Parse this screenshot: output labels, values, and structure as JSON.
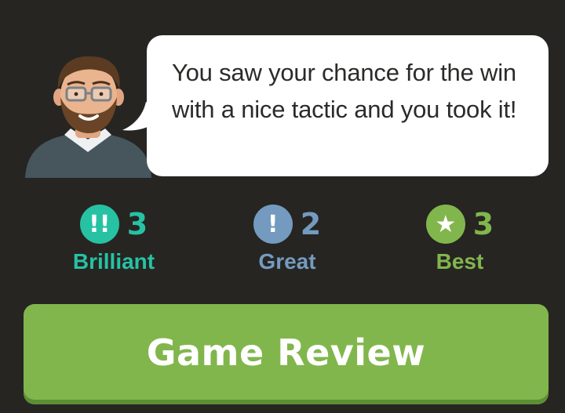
{
  "coach": {
    "avatar_icon": "coach-avatar-icon",
    "message": "You saw your chance for the win with a nice tactic and you took it!"
  },
  "stats": [
    {
      "key": "brilliant",
      "label": "Brilliant",
      "count": "3",
      "icon_text": "!!",
      "icon": "brilliant-move-icon",
      "color": "#26c2a3"
    },
    {
      "key": "great",
      "label": "Great",
      "count": "2",
      "icon_text": "!",
      "icon": "great-move-icon",
      "color": "#749bbf"
    },
    {
      "key": "best",
      "label": "Best",
      "count": "3",
      "icon_text": "★",
      "icon": "best-move-star-icon",
      "color": "#81b64c"
    }
  ],
  "actions": {
    "review_label": "Game Review"
  },
  "colors": {
    "background": "#262522",
    "bubble": "#ffffff",
    "button": "#81b64c"
  }
}
